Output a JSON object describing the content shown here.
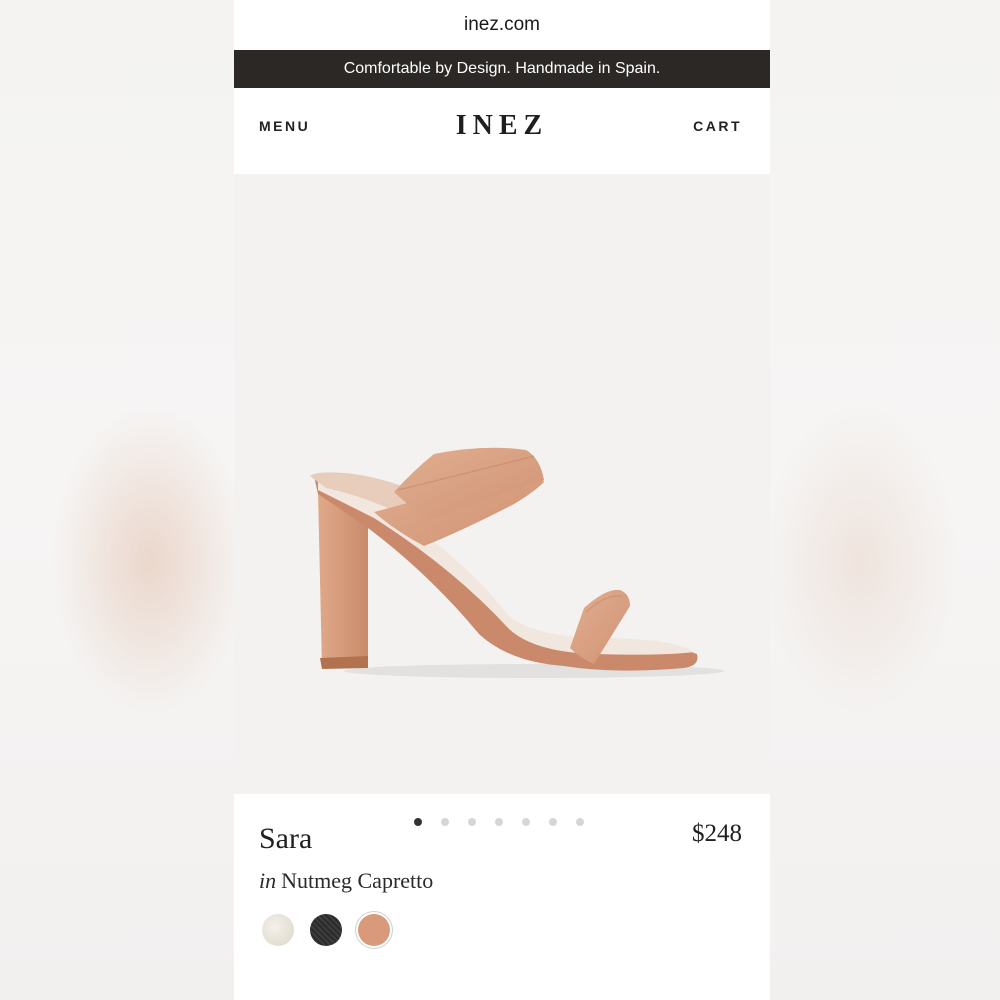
{
  "browser": {
    "url": "inez.com"
  },
  "promo": {
    "text": "Comfortable by Design. Handmade in Spain."
  },
  "nav": {
    "menu_label": "MENU",
    "logo": "INEZ",
    "cart_label": "CART"
  },
  "product": {
    "image_icon": "sandal-product-photo",
    "carousel": {
      "total": 7,
      "active_index": 0
    },
    "name": "Sara",
    "price": "$248",
    "variant_prefix": "in",
    "variant_name": "Nutmeg Capretto",
    "swatches": [
      {
        "name": "cream",
        "color": "#ece8df",
        "selected": false
      },
      {
        "name": "black",
        "color": "#2a2a2a",
        "selected": false
      },
      {
        "name": "nutmeg",
        "color": "#d89a7a",
        "selected": true
      }
    ]
  },
  "colors": {
    "promo_bg": "#2b2826",
    "leather": "#d9a386",
    "sole": "#c27e5c",
    "image_bg": "#f3f2f1"
  }
}
